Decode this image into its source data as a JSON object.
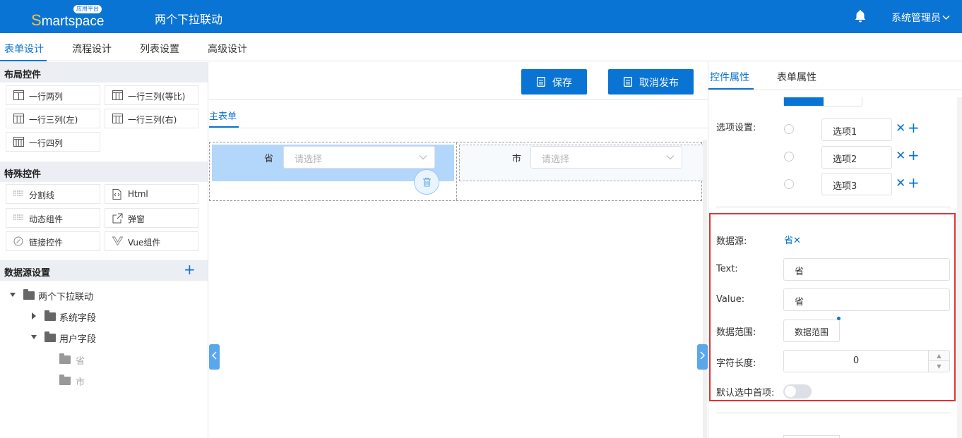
{
  "header": {
    "brand": "martspace",
    "brand_initial": "S",
    "brand_badge": "应用平台",
    "app_title": "两个下拉联动",
    "user": "系统管理员"
  },
  "tabs": [
    {
      "label": "表单设计",
      "active": true
    },
    {
      "label": "流程设计",
      "active": false
    },
    {
      "label": "列表设置",
      "active": false
    },
    {
      "label": "高级设计",
      "active": false
    }
  ],
  "left": {
    "layout_title": "布局控件",
    "layout_controls": [
      "一行两列",
      "一行三列(等比)",
      "一行三列(左)",
      "一行三列(右)",
      "一行四列"
    ],
    "special_title": "特殊控件",
    "special_controls": [
      "分割线",
      "Html",
      "动态组件",
      "弹窗",
      "链接控件",
      "Vue组件"
    ],
    "datasource_title": "数据源设置",
    "tree": {
      "root": "两个下拉联动",
      "system": "系统字段",
      "user": "用户字段",
      "fields": [
        "省",
        "市"
      ]
    }
  },
  "center": {
    "save_label": "保存",
    "unpublish_label": "取消发布",
    "subtab": "主表单",
    "field_a_label": "省",
    "field_b_label": "市",
    "select_placeholder": "请选择"
  },
  "right": {
    "tab_props": "控件属性",
    "tab_form": "表单属性",
    "options_label": "选项设置:",
    "options": [
      "选项1",
      "选项2",
      "选项3"
    ],
    "datasource_label": "数据源:",
    "datasource_value": "省",
    "text_label": "Text:",
    "text_value": "省",
    "value_label": "Value:",
    "value_value": "省",
    "range_label": "数据范围:",
    "range_button": "数据范围",
    "length_label": "字符长度:",
    "length_value": "0",
    "default_first_label": "默认选中首项:",
    "default_first_on": false
  },
  "colors": {
    "primary": "#0a74d4",
    "highlight": "#b3d6fb",
    "annotation_red": "#e03434"
  }
}
